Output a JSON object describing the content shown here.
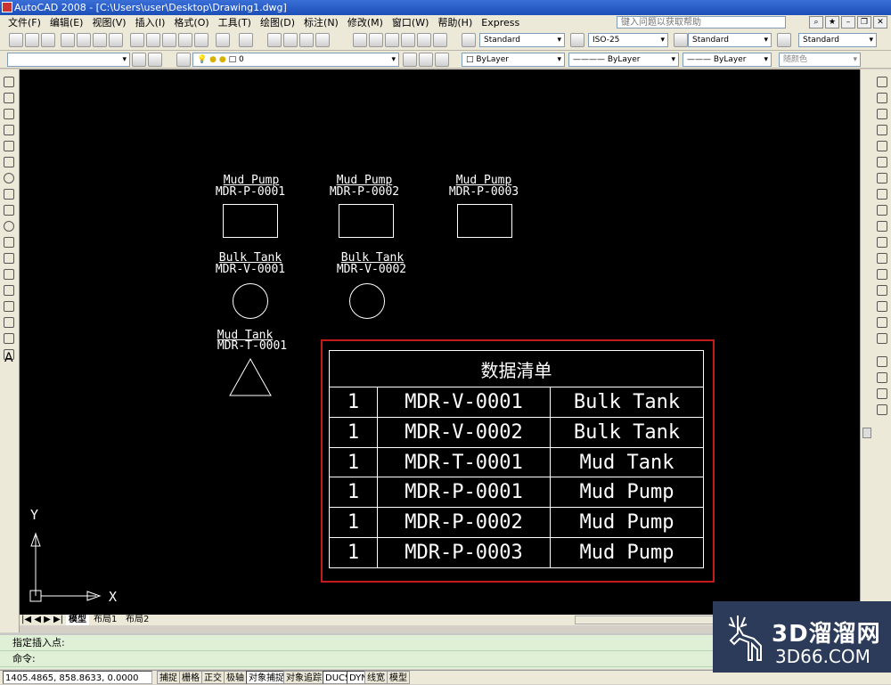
{
  "window": {
    "title": "AutoCAD 2008 - [C:\\Users\\user\\Desktop\\Drawing1.dwg]"
  },
  "menu": [
    "文件(F)",
    "编辑(E)",
    "视图(V)",
    "插入(I)",
    "格式(O)",
    "工具(T)",
    "绘图(D)",
    "标注(N)",
    "修改(M)",
    "窗口(W)",
    "帮助(H)",
    "Express"
  ],
  "help_search": {
    "placeholder": "键入问题以获取帮助"
  },
  "styles": {
    "text_style": "Standard",
    "dim_style": "ISO-25",
    "table_style": "Standard",
    "multileader_style": "Standard"
  },
  "layers": {
    "current_layer": "0",
    "color": "ByLayer",
    "linetype": "ByLayer",
    "lineweight": "ByLayer",
    "plotstyle": "随颜色"
  },
  "equipment": [
    {
      "name": "Mud Pump",
      "tag": "MDR-P-0001",
      "shape": "rectangle"
    },
    {
      "name": "Mud Pump",
      "tag": "MDR-P-0002",
      "shape": "rectangle"
    },
    {
      "name": "Mud Pump",
      "tag": "MDR-P-0003",
      "shape": "rectangle"
    },
    {
      "name": "Bulk Tank",
      "tag": "MDR-V-0001",
      "shape": "circle"
    },
    {
      "name": "Bulk Tank",
      "tag": "MDR-V-0002",
      "shape": "circle"
    },
    {
      "name": "Mud Tank",
      "tag": "MDR-T-0001",
      "shape": "triangle"
    }
  ],
  "table": {
    "title": "数据清单",
    "rows": [
      {
        "qty": "1",
        "tag": "MDR-V-0001",
        "name": "Bulk Tank"
      },
      {
        "qty": "1",
        "tag": "MDR-V-0002",
        "name": "Bulk Tank"
      },
      {
        "qty": "1",
        "tag": "MDR-T-0001",
        "name": "Mud Tank"
      },
      {
        "qty": "1",
        "tag": "MDR-P-0001",
        "name": "Mud Pump"
      },
      {
        "qty": "1",
        "tag": "MDR-P-0002",
        "name": "Mud Pump"
      },
      {
        "qty": "1",
        "tag": "MDR-P-0003",
        "name": "Mud Pump"
      }
    ]
  },
  "ucs": {
    "x": "X",
    "y": "Y"
  },
  "tabs": [
    "模型",
    "布局1",
    "布局2"
  ],
  "command": {
    "prompt1": "指定插入点:",
    "prompt2": "命令:"
  },
  "status": {
    "coords": "1405.4865, 858.8633, 0.0000",
    "buttons": [
      "捕捉",
      "栅格",
      "正交",
      "极轴",
      "对象捕捉",
      "对象追踪",
      "DUCS",
      "DYN",
      "线宽",
      "模型"
    ]
  },
  "watermark": {
    "brand": "3D溜溜网",
    "url": "3D66.COM"
  }
}
